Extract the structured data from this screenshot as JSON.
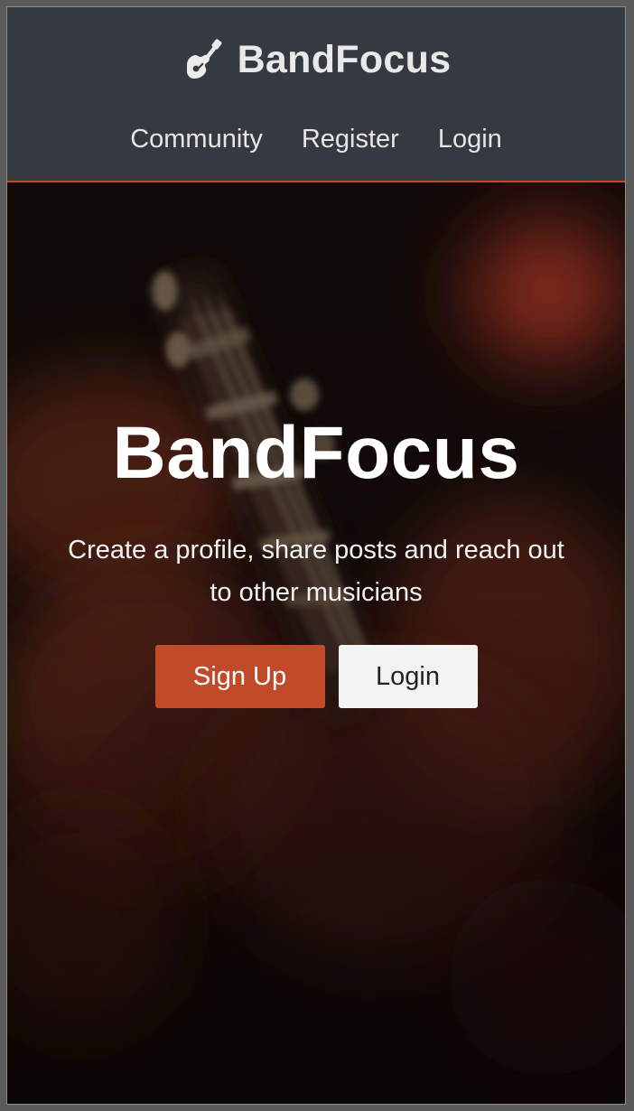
{
  "navbar": {
    "brand": {
      "icon": "guitar-icon",
      "text": "BandFocus"
    },
    "links": [
      {
        "label": "Community"
      },
      {
        "label": "Register"
      },
      {
        "label": "Login"
      }
    ]
  },
  "hero": {
    "background": "blurred-guitar-headstock-photo",
    "title": "BandFocus",
    "subtitle": "Create a profile, share posts and reach out to other musicians",
    "buttons": {
      "signup_label": "Sign Up",
      "login_label": "Login"
    }
  },
  "colors": {
    "navbar_bg": "#343a40",
    "accent": "#c14a28",
    "light_button_bg": "#f3f3f3"
  }
}
